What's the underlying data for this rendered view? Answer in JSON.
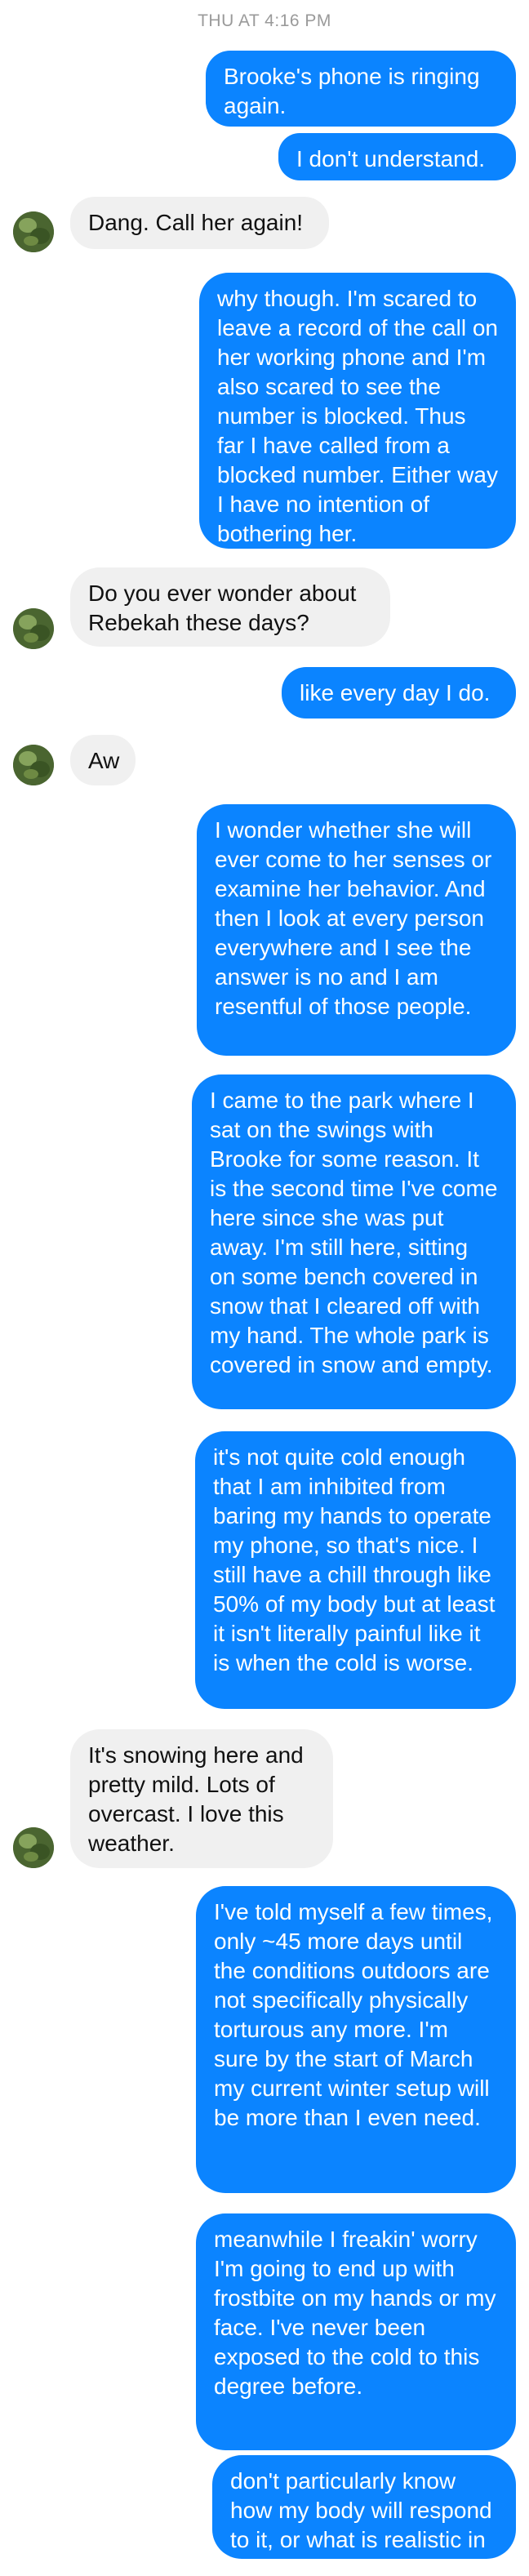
{
  "thread": {
    "timestamp": "THU AT 4:16 PM",
    "messages": [
      {
        "from": "me",
        "text": "Brooke's phone is ringing again."
      },
      {
        "from": "me",
        "text": "I don't understand."
      },
      {
        "from": "them",
        "text": "Dang. Call her again!"
      },
      {
        "from": "me",
        "text": "why though. I'm scared to leave a record of the call on her working phone and I'm also scared to see the number is blocked. Thus far I have called from a blocked number. Either way I have no intention of bothering her."
      },
      {
        "from": "them",
        "text": "Do you ever wonder about Rebekah these days?"
      },
      {
        "from": "me",
        "text": "like every day I do."
      },
      {
        "from": "them",
        "text": "Aw"
      },
      {
        "from": "me",
        "text": "I wonder whether she will ever come to her senses or examine her behavior. And then I look at every person everywhere and I see the answer is no and I am resentful of those people."
      },
      {
        "from": "me",
        "text": "I came to the park where I sat on the swings with Brooke for some reason. It is the second time I've come here since she was put away. I'm still here, sitting on some bench covered in snow that I cleared off with my hand. The whole park is covered in snow and empty."
      },
      {
        "from": "me",
        "text": "it's not quite cold enough that I am inhibited from baring my hands to operate my phone, so that's nice. I still have a chill through like 50% of my body but at least it isn't literally painful like it is when the cold is worse."
      },
      {
        "from": "them",
        "text": "It's snowing here and pretty mild. Lots of overcast. I love this weather."
      },
      {
        "from": "me",
        "text": "I've told myself a few times, only ~45 more days until the conditions outdoors are not specifically physically torturous any more. I'm sure by the start of March my current winter setup will be more than I even need."
      },
      {
        "from": "me",
        "text": "meanwhile I freakin' worry I'm going to end up with frostbite on my hands or my face. I've never been exposed to the cold to this degree before."
      },
      {
        "from": "me",
        "text": "don't particularly know how my body will respond to it, or what is realistic in general, in other words."
      }
    ]
  },
  "colors": {
    "sent_bubble": "#0b84ff",
    "received_bubble": "#f0f0f0",
    "timestamp": "#9a9a9a"
  },
  "icons": {
    "avatar": "contact-avatar-photo"
  }
}
